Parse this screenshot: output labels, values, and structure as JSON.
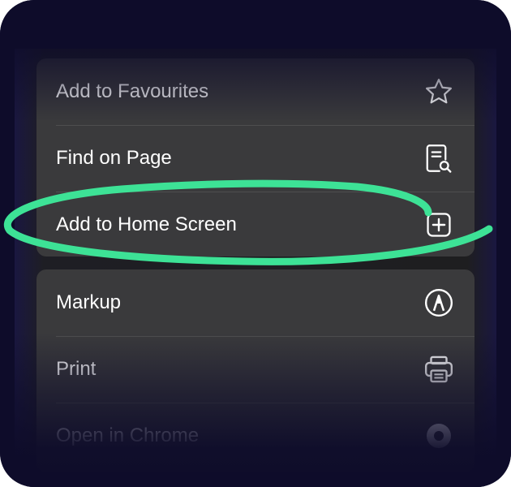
{
  "menu": {
    "group1": [
      {
        "label": "Add to Favourites",
        "icon": "star-icon"
      },
      {
        "label": "Find on Page",
        "icon": "find-document-icon"
      },
      {
        "label": "Add to Home Screen",
        "icon": "add-square-icon"
      }
    ],
    "group2": [
      {
        "label": "Markup",
        "icon": "markup-pen-icon"
      },
      {
        "label": "Print",
        "icon": "printer-icon"
      },
      {
        "label": "Open in Chrome",
        "icon": "chrome-icon"
      }
    ]
  },
  "colors": {
    "highlight": "#3de296",
    "background": "#0e0c2a",
    "panel": "#3a3a3c"
  }
}
